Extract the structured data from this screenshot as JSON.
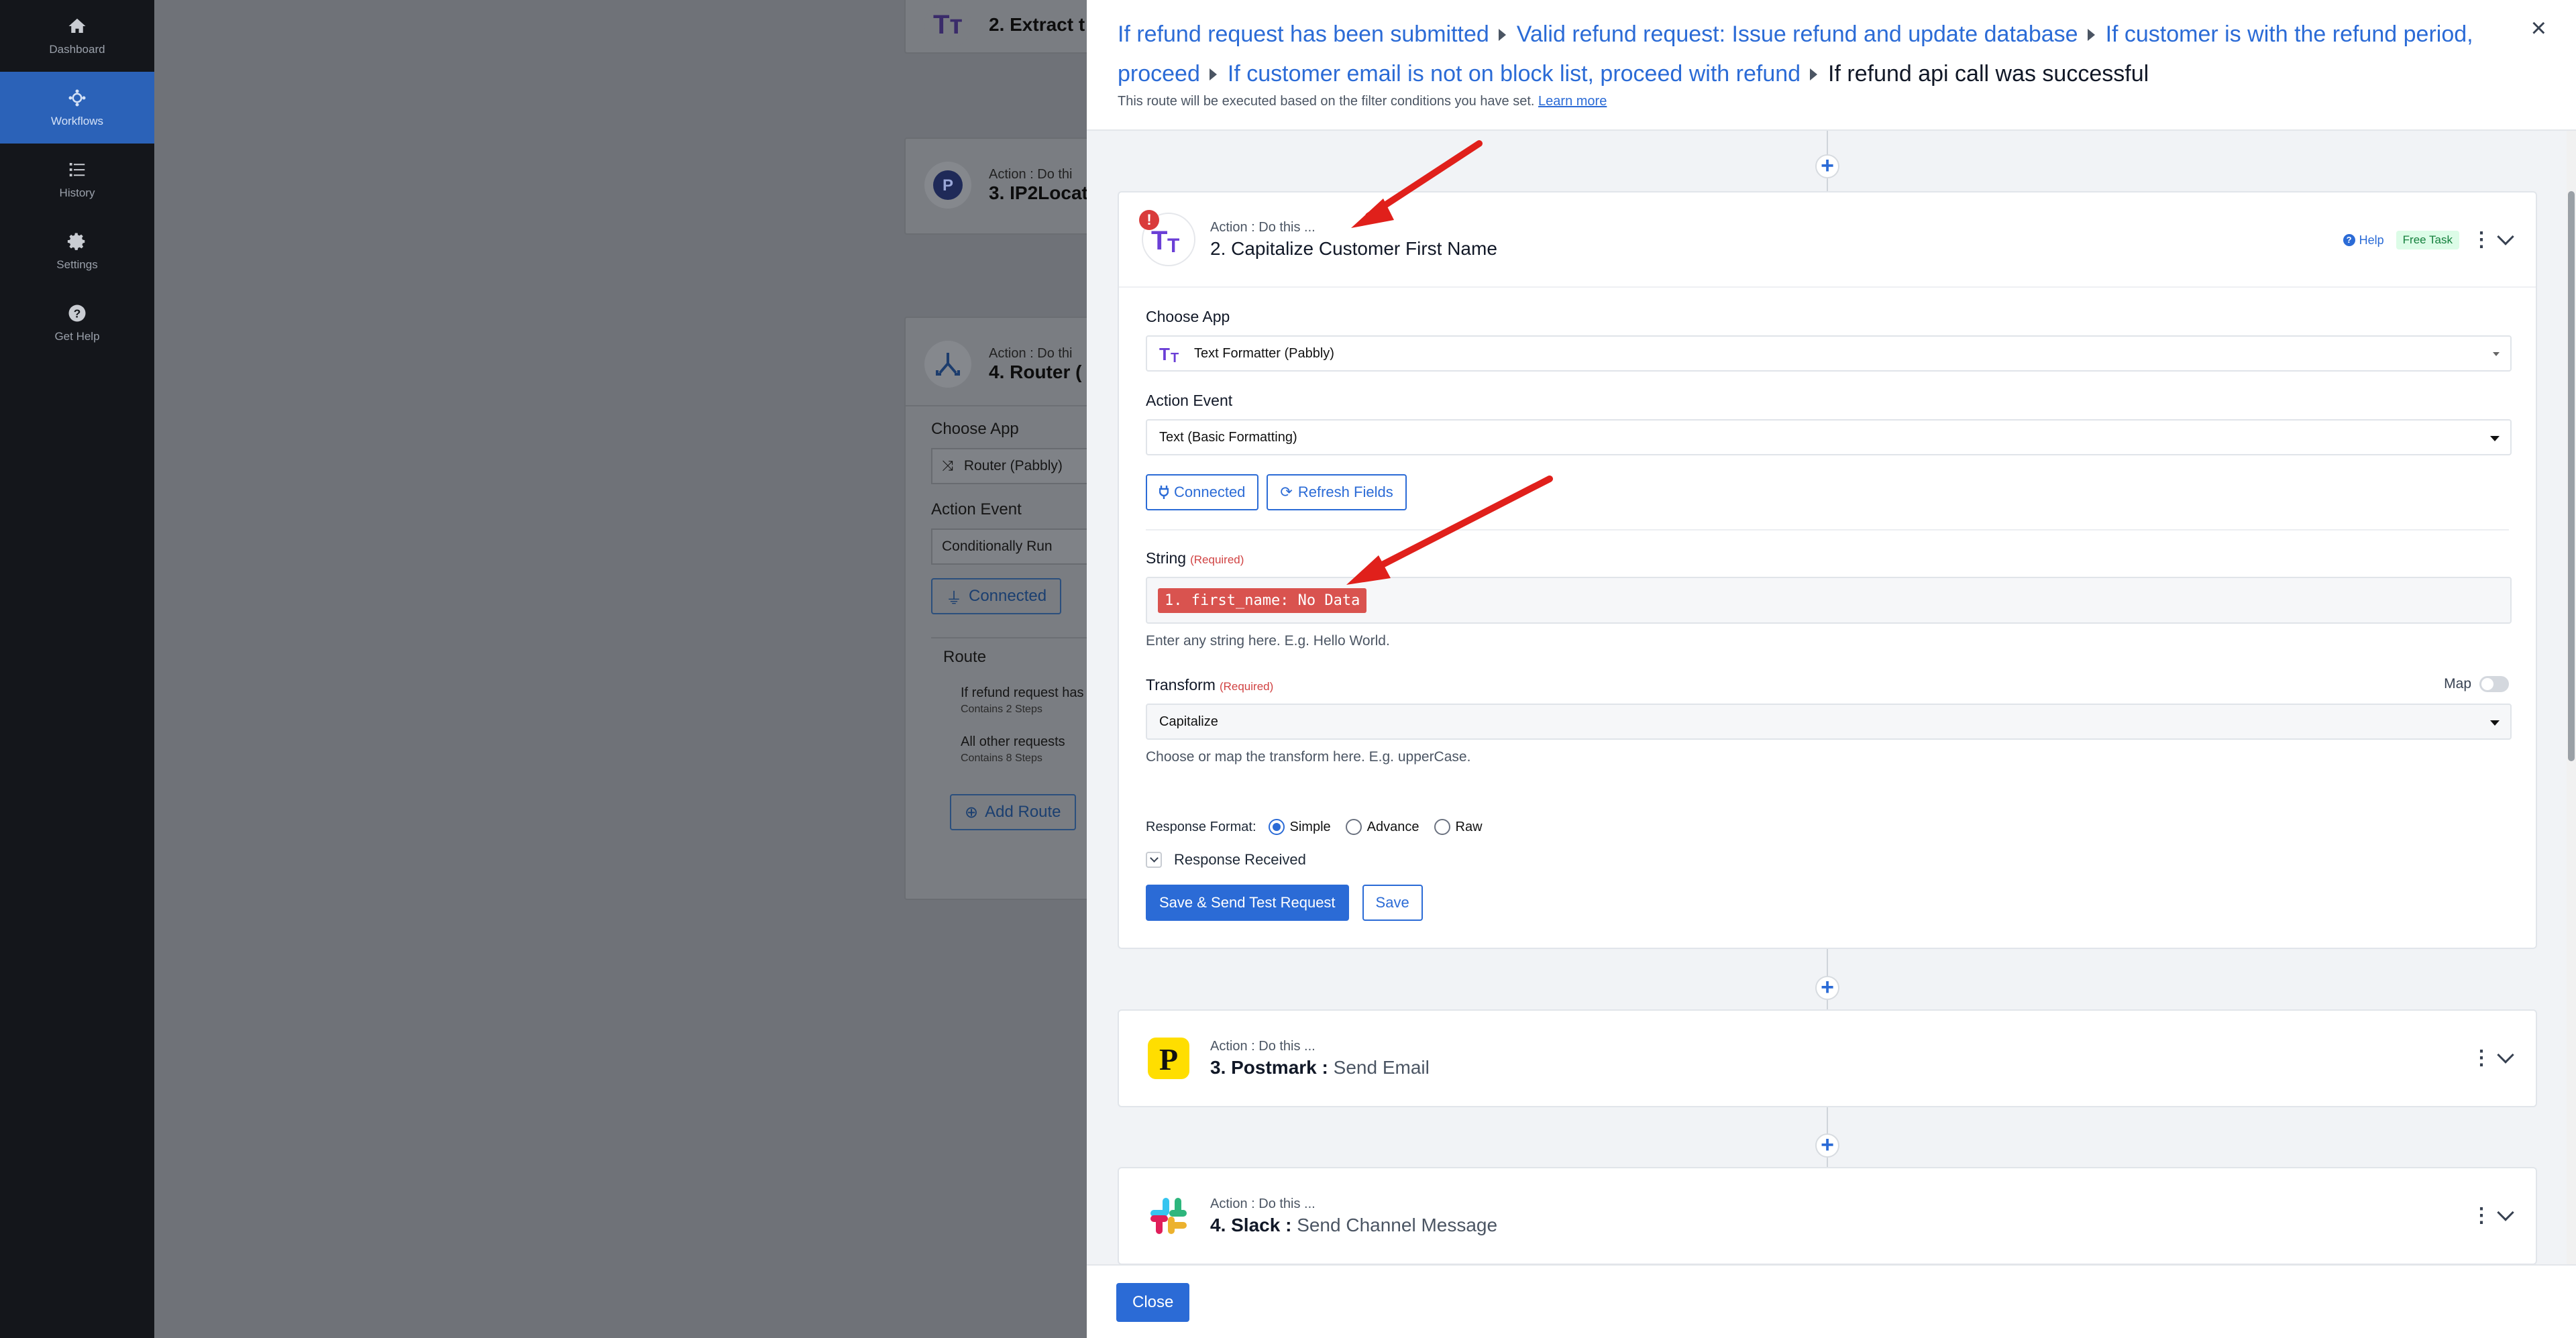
{
  "sidebar": {
    "items": [
      {
        "label": "Dashboard",
        "icon": "home-icon"
      },
      {
        "label": "Workflows",
        "icon": "workflows-icon",
        "active": true
      },
      {
        "label": "History",
        "icon": "history-icon"
      },
      {
        "label": "Settings",
        "icon": "gear-icon"
      },
      {
        "label": "Get Help",
        "icon": "help-icon"
      }
    ]
  },
  "background_canvas": {
    "card_extract": {
      "title": "2. Extract t"
    },
    "card_ip2": {
      "small": "Action : Do thi",
      "title": "3. IP2Locat"
    },
    "card_router": {
      "small": "Action : Do thi",
      "title": "4. Router (",
      "choose_app_label": "Choose App",
      "app_value": "Router (Pabbly)",
      "action_event_label": "Action Event",
      "action_event_value": "Conditionally Run",
      "connected_label": "Connected",
      "route_label": "Route",
      "routes": [
        {
          "name": "If refund request has",
          "sub": "Contains 2 Steps"
        },
        {
          "name": "All other requests",
          "sub": "Contains 8 Steps"
        }
      ],
      "add_route_label": "Add Route"
    }
  },
  "drawer": {
    "breadcrumbs": [
      "If refund request has been submitted",
      "Valid refund request: Issue refund and update database",
      "If customer is with the refund period, proceed",
      "If customer email is not on block list, proceed with refund",
      "If refund api call was successful"
    ],
    "route_note": "This route will be executed based on the filter conditions you have set.",
    "learn_more": "Learn more",
    "close_x": "×",
    "close_button": "Close"
  },
  "step_active": {
    "small": "Action : Do this ...",
    "title": "2. Capitalize Customer First Name",
    "help": "Help",
    "badge": "Free Task",
    "choose_app_label": "Choose App",
    "app_value": "Text Formatter (Pabbly)",
    "action_event_label": "Action Event",
    "action_event_value": "Text (Basic Formatting)",
    "connected_label": "Connected",
    "refresh_label": "Refresh Fields",
    "string_label": "String",
    "required": "(Required)",
    "string_chip": "1. first_name: No Data",
    "string_hint": "Enter any string here. E.g. Hello World.",
    "transform_label": "Transform",
    "map_label": "Map",
    "transform_value": "Capitalize",
    "transform_hint": "Choose or map the transform here. E.g. upperCase.",
    "response_format_label": "Response Format:",
    "formats": [
      "Simple",
      "Advance",
      "Raw"
    ],
    "selected_format": "Simple",
    "response_received": "Response Received",
    "save_send_label": "Save & Send Test Request",
    "save_label": "Save"
  },
  "step_postmark": {
    "small": "Action : Do this ...",
    "app": "3. Postmark :",
    "event": "Send Email"
  },
  "step_slack": {
    "small": "Action : Do this ...",
    "app": "4. Slack :",
    "event": "Send Channel Message"
  },
  "colors": {
    "accent": "#2b6bd6",
    "sidebar": "#14161b",
    "active_nav": "#2b62b8",
    "error_chip": "#d9534f",
    "annotation_arrow": "#e0201b"
  }
}
